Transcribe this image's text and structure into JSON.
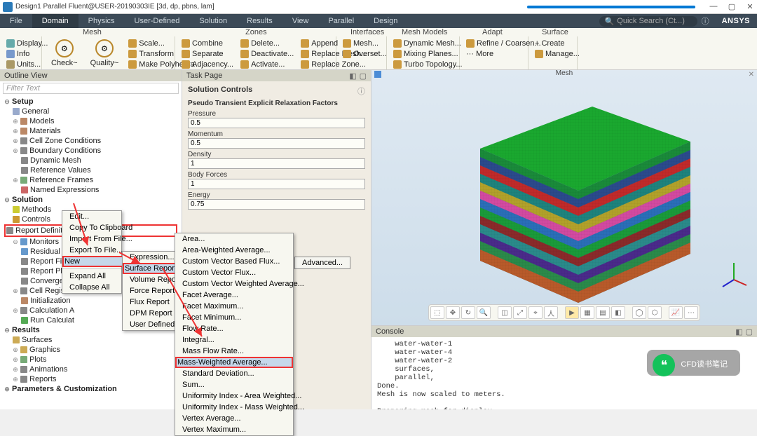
{
  "title": "Design1 Parallel Fluent@USER-20190303IE  [3d, dp, pbns, lam]",
  "menus": [
    "File",
    "Domain",
    "Physics",
    "User-Defined",
    "Solution",
    "Results",
    "View",
    "Parallel",
    "Design"
  ],
  "menu_active": 1,
  "search_placeholder": "Quick Search (Ct...)",
  "brand": "ANSYS",
  "ribbon": {
    "grp1": {
      "btns": [
        "Display...",
        "Info",
        "Units..."
      ]
    },
    "grp_mesh": {
      "label": "Mesh",
      "bigs": [
        "Check~",
        "Quality~"
      ],
      "col": [
        "Scale...",
        "Transform",
        "Make Polyhedra"
      ]
    },
    "grp_zones": {
      "label": "Zones",
      "c1": [
        "Combine",
        "Separate",
        "Adjacency..."
      ],
      "c2": [
        "Delete...",
        "Deactivate...",
        "Activate..."
      ],
      "c3": [
        "Append",
        "Replace Mesh...",
        "Replace Zone..."
      ]
    },
    "grp_interf": {
      "label": "Interfaces",
      "c": [
        "Mesh...",
        "Overset..."
      ]
    },
    "grp_meshmod": {
      "label": "Mesh Models",
      "c": [
        "Dynamic Mesh...",
        "Mixing Planes...",
        "Turbo Topology..."
      ]
    },
    "grp_adapt": {
      "label": "Adapt",
      "c": [
        "Refine / Coarsen...",
        "··· More"
      ]
    },
    "grp_surf": {
      "label": "Surface",
      "c": [
        "+ Create",
        "Manage..."
      ]
    }
  },
  "outline": {
    "head": "Outline View",
    "filter": "Filter Text",
    "setup": "Setup",
    "s_items": [
      "General",
      "Models",
      "Materials",
      "Cell Zone Conditions",
      "Boundary Conditions",
      "Dynamic Mesh",
      "Reference Values",
      "Reference Frames",
      "Named Expressions"
    ],
    "solution": "Solution",
    "sol_items": [
      "Methods",
      "Controls",
      "Report Definitions",
      "Monitors",
      "Residual",
      "Report Fi",
      "Report Pl",
      "Converge",
      "Cell Register",
      "Initialization",
      "Calculation A",
      "Run Calculat"
    ],
    "results": "Results",
    "res_items": [
      "Surfaces",
      "Graphics",
      "Plots",
      "Animations",
      "Reports"
    ],
    "params": "Parameters & Customization"
  },
  "ctx1": [
    "Edit...",
    "Copy To Clipboard",
    "Import From File...",
    "Export To File...",
    "New",
    "Expand All",
    "Collapse All"
  ],
  "ctx2": [
    "Expression...",
    "Surface Report",
    "Volume Report",
    "Force Report",
    "Flux Report",
    "DPM Report",
    "User Defined..."
  ],
  "ctx3": [
    "Area...",
    "Area-Weighted Average...",
    "Custom Vector Based Flux...",
    "Custom Vector Flux...",
    "Custom Vector Weighted Average...",
    "Facet Average...",
    "Facet Maximum...",
    "Facet Minimum...",
    "Flow Rate...",
    "Integral...",
    "Mass Flow Rate...",
    "Mass-Weighted Average...",
    "Standard Deviation...",
    "Sum...",
    "Uniformity Index - Area Weighted...",
    "Uniformity Index - Mass Weighted...",
    "Vertex Average...",
    "Vertex Maximum..."
  ],
  "task": {
    "head": "Task Page",
    "title": "Solution Controls",
    "sub": "Pseudo Transient Explicit Relaxation Factors",
    "fields": [
      {
        "label": "Pressure",
        "value": "0.5"
      },
      {
        "label": "Momentum",
        "value": "0.5"
      },
      {
        "label": "Density",
        "value": "1"
      },
      {
        "label": "Body Forces",
        "value": "1"
      },
      {
        "label": "Energy",
        "value": "0.75"
      }
    ],
    "adv": "Advanced..."
  },
  "mesh_head": "Mesh",
  "console_head": "Console",
  "console_text": "    water-water-1\n    water-water-4\n    water-water-2\n    surfaces,\n    parallel,\nDone.\nMesh is now scaled to meters.\n\nPreparing mesh for display...\nDone.",
  "watermark": "CFD读书笔记"
}
